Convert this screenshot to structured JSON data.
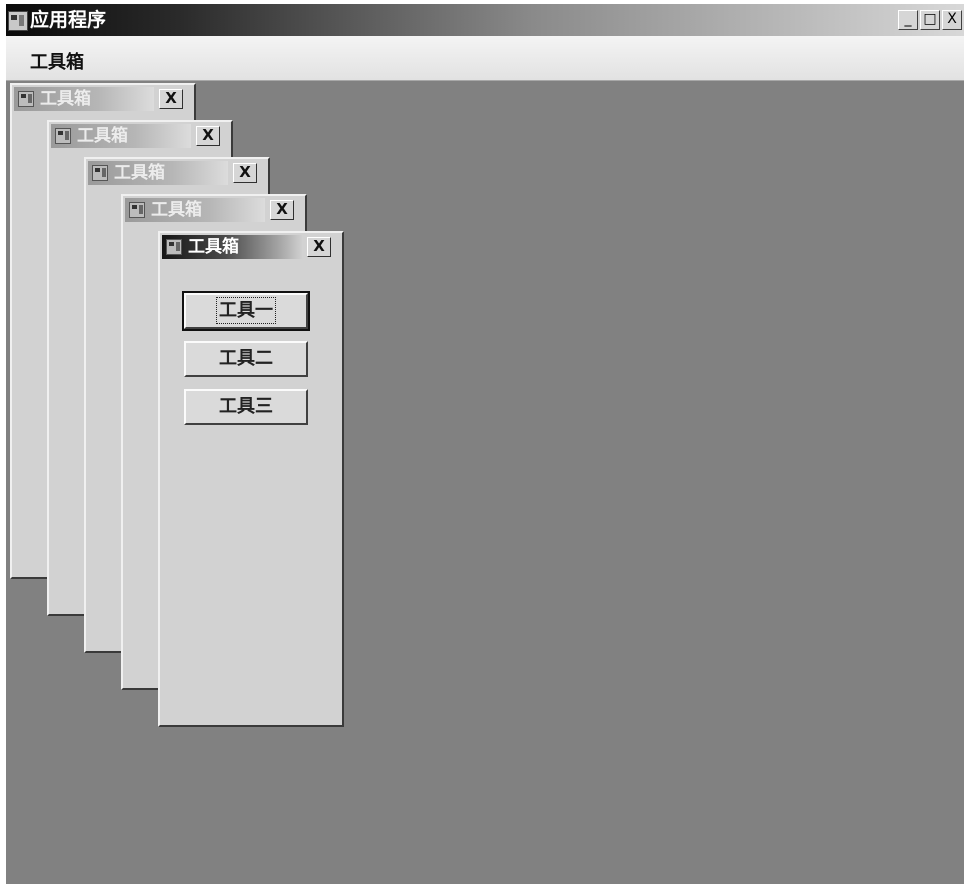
{
  "window": {
    "title": "应用程序",
    "controls": {
      "minimize": "_",
      "maximize": "□",
      "close": "X"
    }
  },
  "menu": {
    "items": [
      {
        "label": "工具箱"
      }
    ]
  },
  "toolbox_windows": [
    {
      "title": "工具箱",
      "close": "X"
    },
    {
      "title": "工具箱",
      "close": "X"
    },
    {
      "title": "工具箱",
      "close": "X"
    },
    {
      "title": "工具箱",
      "close": "X"
    },
    {
      "title": "工具箱",
      "close": "X",
      "active": true,
      "buttons": [
        {
          "label": "工具一"
        },
        {
          "label": "工具二"
        },
        {
          "label": "工具三"
        }
      ]
    }
  ],
  "colors": {
    "mdi_background": "#818181",
    "title_active_start": "#151515",
    "title_inactive": "#9a9a9a"
  }
}
